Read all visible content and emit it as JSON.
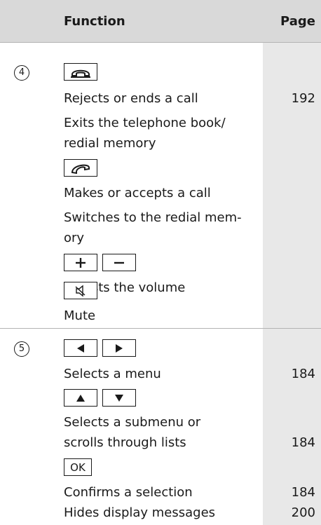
{
  "header": {
    "function_label": "Function",
    "page_label": "Page"
  },
  "sections": [
    {
      "number": "4",
      "items": [
        {
          "text": "Rejects or ends a call",
          "page": "192"
        },
        {
          "text": "Exits the telephone book/",
          "page": ""
        },
        {
          "text": "redial memory",
          "page": ""
        },
        {
          "text": "Makes or accepts a call",
          "page": ""
        },
        {
          "text": "Switches to the redial mem-",
          "page": ""
        },
        {
          "text": "ory",
          "page": ""
        },
        {
          "text": "Adjusts the volume",
          "page": ""
        },
        {
          "text": "Mute",
          "page": ""
        }
      ],
      "keys": [
        "end-call-icon",
        "accept-call-icon",
        "plus-icon",
        "minus-icon",
        "mute-icon"
      ]
    },
    {
      "number": "5",
      "items": [
        {
          "text": "Selects a menu",
          "page": "184"
        },
        {
          "text": "Selects a submenu or",
          "page": ""
        },
        {
          "text": "scrolls through lists",
          "page": "184"
        },
        {
          "text": "Confirms a selection",
          "page": "184"
        },
        {
          "text": "Hides display messages",
          "page": "200"
        }
      ],
      "keys": [
        "left-arrow-icon",
        "right-arrow-icon",
        "up-arrow-icon",
        "down-arrow-icon"
      ],
      "ok_label": "OK"
    }
  ],
  "colors": {
    "header_bg": "#d9d9d9",
    "page_column_bg": "#e8e8e8"
  }
}
